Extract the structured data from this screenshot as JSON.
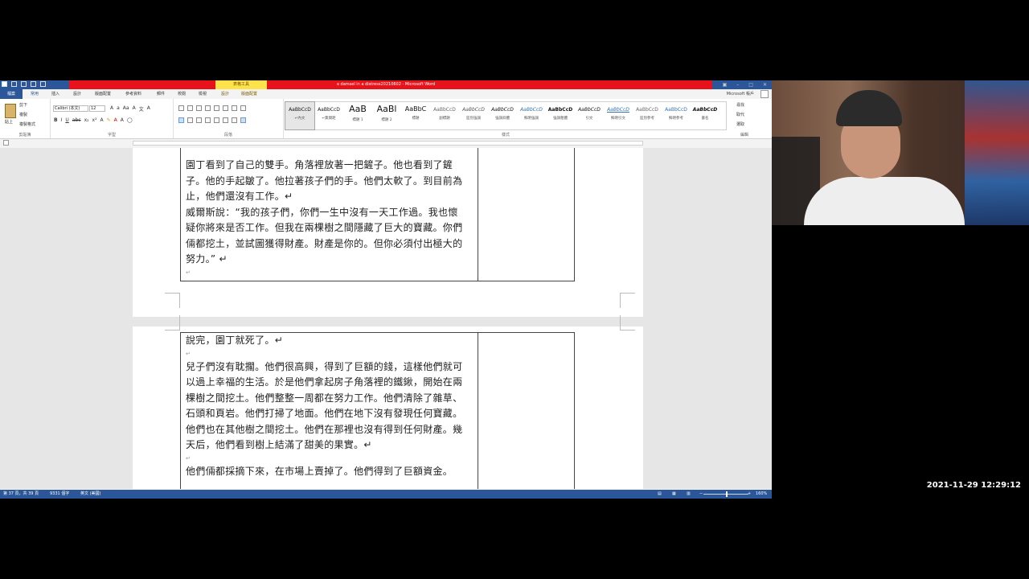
{
  "window": {
    "title": "a damsel in a distress20210602 - Microsoft Word",
    "context_tab_group": "表格工具"
  },
  "tabs": {
    "file": "檔案",
    "items": [
      "常用",
      "插入",
      "設計",
      "版面配置",
      "參考資料",
      "郵件",
      "校閱",
      "檢視",
      "設計",
      "版面配置"
    ],
    "account": "Microsoft 帳戶"
  },
  "ribbon": {
    "clipboard": {
      "paste": "貼上",
      "cut": "剪下",
      "copy": "複製",
      "format_painter": "複製格式",
      "group": "剪貼簿"
    },
    "font": {
      "name": "Calibri (本文)",
      "size": "12",
      "group": "字型"
    },
    "paragraph": {
      "group": "段落"
    },
    "styles": {
      "group": "樣式",
      "items": [
        {
          "preview": "AaBbCcD",
          "name": "↵內文"
        },
        {
          "preview": "AaBbCcD",
          "name": "↵無間距"
        },
        {
          "preview": "AaB",
          "name": "標題 1"
        },
        {
          "preview": "AaBl",
          "name": "標題 2"
        },
        {
          "preview": "AaBbC",
          "name": "標題"
        },
        {
          "preview": "AaBbCcD",
          "name": "副標題"
        },
        {
          "preview": "AaBbCcD",
          "name": "區別強調"
        },
        {
          "preview": "AaBbCcD",
          "name": "強調斜體"
        },
        {
          "preview": "AaBbCcD",
          "name": "鮮明強調"
        },
        {
          "preview": "AaBbCcD",
          "name": "強調粗體"
        },
        {
          "preview": "AaBbCcD",
          "name": "引文"
        },
        {
          "preview": "AaBbCcD",
          "name": "鮮明引文"
        },
        {
          "preview": "AaBbCcD",
          "name": "區別參考"
        },
        {
          "preview": "AaBbCcD",
          "name": "鮮明參考"
        },
        {
          "preview": "AaBbCcD",
          "name": "書名"
        }
      ]
    },
    "editing": {
      "find": "尋找",
      "replace": "取代",
      "select": "選取",
      "group": "編輯"
    }
  },
  "document": {
    "page1_paragraphs": [
      "園丁看到了自己的雙手。角落裡放著一把鏟子。他也看到了鏟子。他的手起皺了。他拉著孩子們的手。他們太軟了。到目前為止，他們還沒有工作。↵",
      "威爾斯說：“我的孩子們，你們一生中沒有一天工作過。我也懷疑你將來是否工作。但我在兩棵樹之間隱藏了巨大的寶藏。你們倆都挖土，並試圖獲得財產。財產是你的。但你必須付出極大的努力。” ↵"
    ],
    "page2_paragraphs": [
      "說完，園丁就死了。↵",
      "兒子們沒有耽擱。他們很高興，得到了巨額的錢，這樣他們就可以過上幸福的生活。於是他們拿起房子角落裡的鐵鍬，開始在兩棵樹之間挖土。他們整整一周都在努力工作。他們清除了雜草、石頭和頁岩。他們打掃了地面。他們在地下沒有發現任何寶藏。他們也在其他樹之間挖土。他們在那裡也沒有得到任何財產。幾天后，他們看到樹上結滿了甜美的果實。↵",
      "他們倆都採摘下來，在市場上賣掉了。他們得到了巨額資金。"
    ],
    "paragraph_mark": "↵"
  },
  "statusbar": {
    "page": "第 37 頁，共 39 頁",
    "words": "9331 個字",
    "language": "英文 (美國)",
    "zoom": "160%"
  },
  "overlay": {
    "timestamp": "2021-11-29 12:29:12"
  }
}
